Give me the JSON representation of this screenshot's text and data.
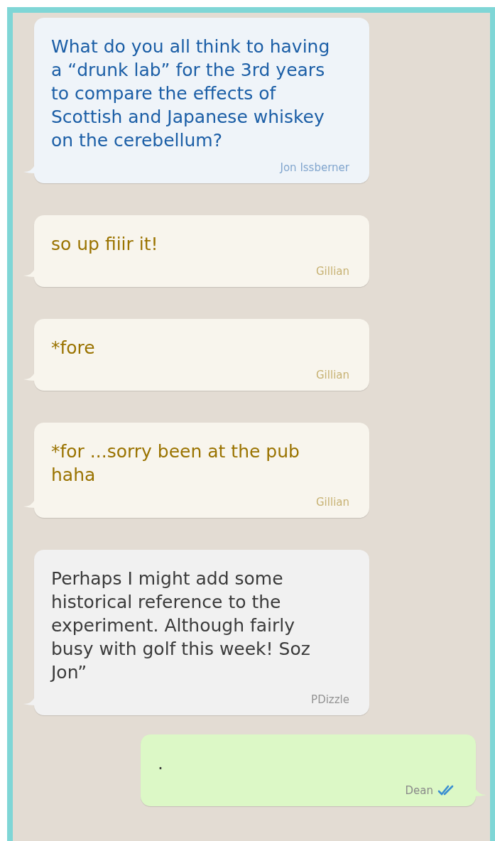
{
  "messages": [
    {
      "kind": "incoming",
      "text": "What do you all think to having\na “drunk lab” for the 3rd years\nto compare the effects of\nScottish and Japanese whiskey\non the cerebellum?",
      "sender": "Jon Issberner",
      "color": "#1b5ea6"
    },
    {
      "kind": "incoming",
      "text": "so up fiiir it!",
      "sender": "Gillian",
      "color": "#9a7300"
    },
    {
      "kind": "incoming",
      "text": "*fore",
      "sender": "Gillian",
      "color": "#9a7300"
    },
    {
      "kind": "incoming",
      "text": "*for ...sorry been at the pub\nhaha",
      "sender": "Gillian",
      "color": "#9a7300"
    },
    {
      "kind": "incoming",
      "text": "Perhaps I might add some\nhistorical reference to the\nexperiment. Although fairly\nbusy with golf this week! Soz\nJon”",
      "sender": "PDizzle",
      "color": "#3a3a3a"
    },
    {
      "kind": "outgoing",
      "text": ".",
      "sender": "Dean",
      "color": "#3a3a3a",
      "read": true
    }
  ]
}
